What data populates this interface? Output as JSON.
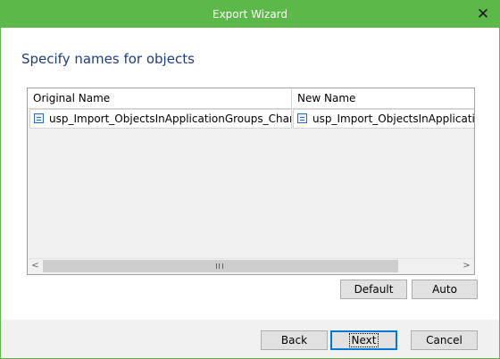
{
  "window": {
    "title": "Export Wizard",
    "close_symbol": "✕"
  },
  "page": {
    "heading": "Specify names for objects"
  },
  "grid": {
    "columns": [
      "Original Name",
      "New Name"
    ],
    "rows": [
      {
        "original_name": "usp_Import_ObjectsInApplicationGroups_Changes",
        "new_name": "usp_Import_ObjectsInApplicationGroups_Changes",
        "icon": "stored-procedure-icon"
      }
    ],
    "scroll_left_symbol": "<",
    "scroll_right_symbol": ">"
  },
  "actions": {
    "default_label": "Default",
    "auto_label": "Auto"
  },
  "footer": {
    "back_label": "Back",
    "next_label": "Next",
    "cancel_label": "Cancel"
  },
  "colors": {
    "titlebar": "#5cb849",
    "heading": "#1e3f7c"
  }
}
